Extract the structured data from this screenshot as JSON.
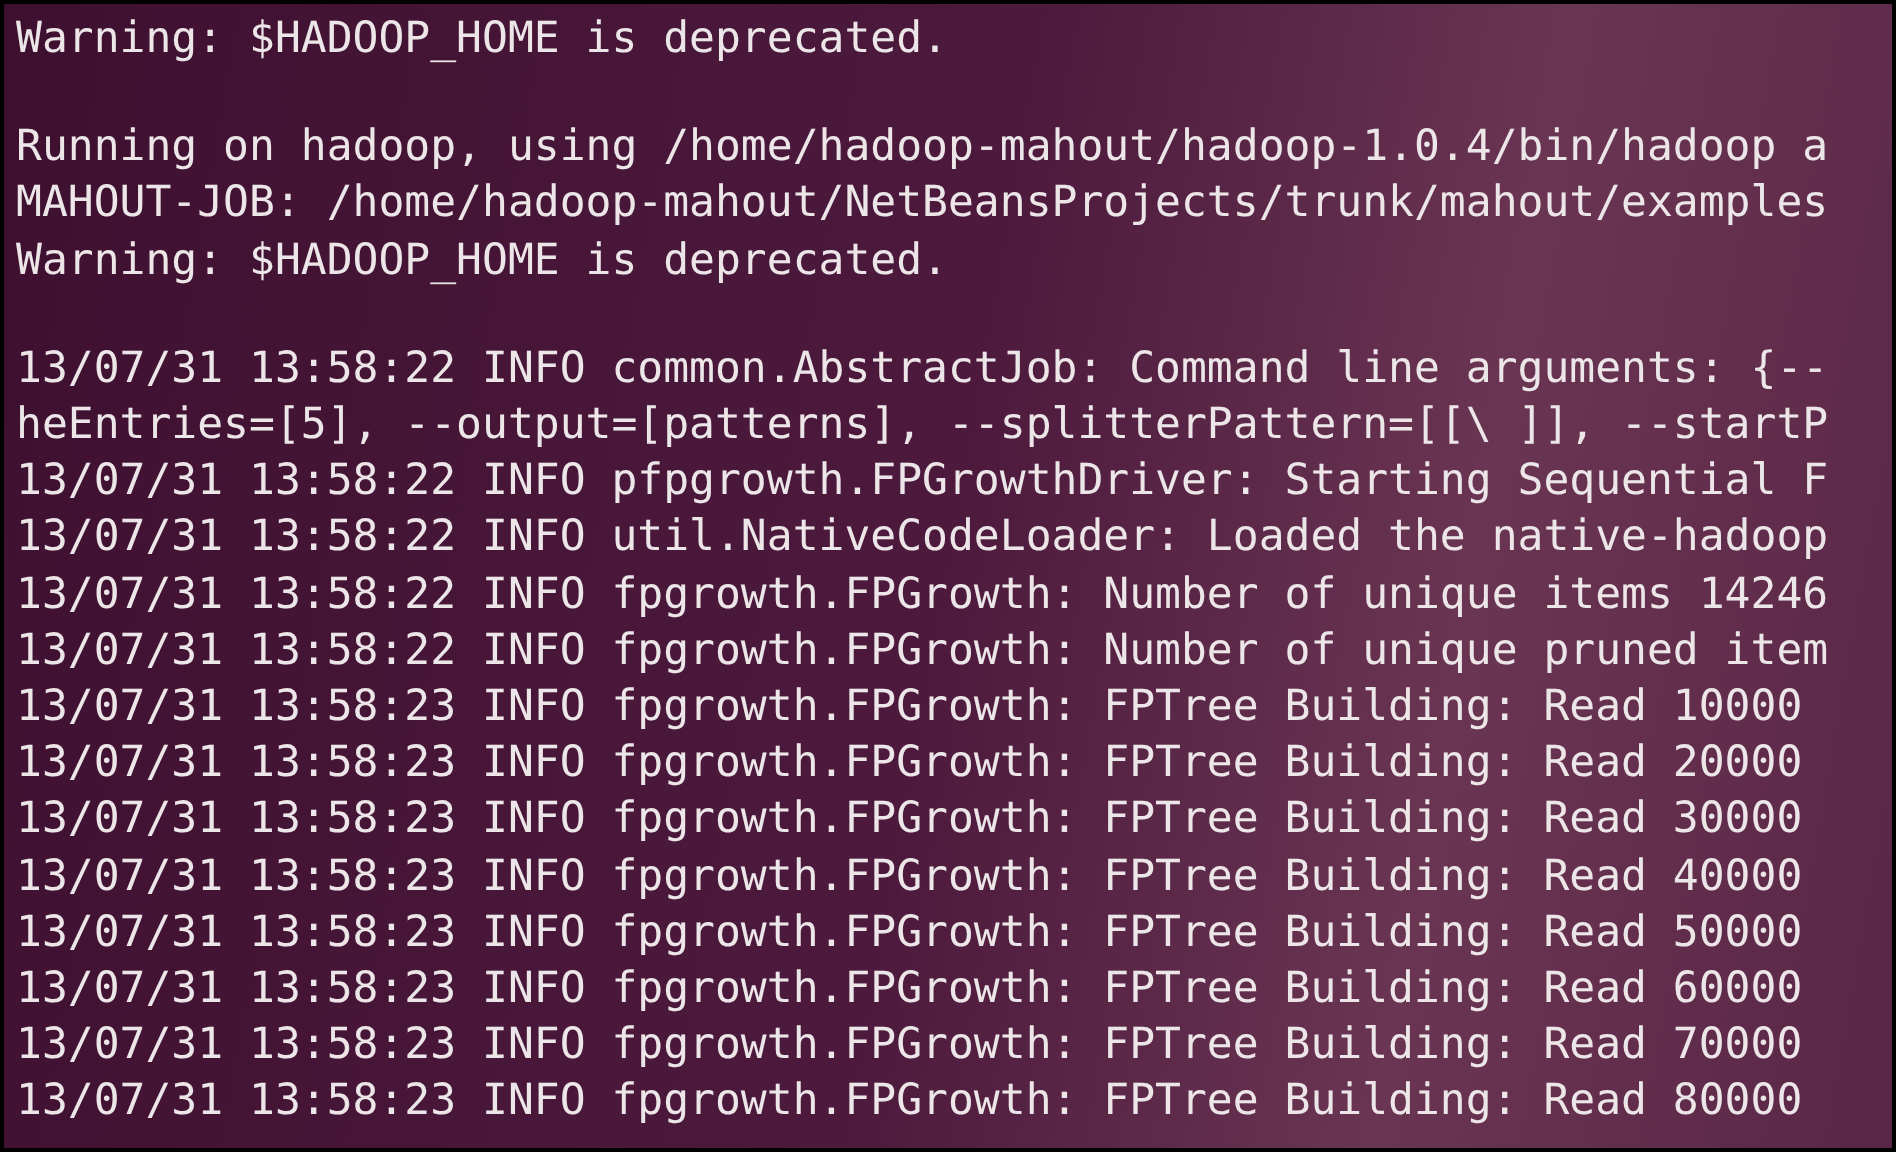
{
  "terminal": {
    "blocks": [
      [
        "Warning: $HADOOP_HOME is deprecated."
      ],
      [
        "Running on hadoop, using /home/hadoop-mahout/hadoop-1.0.4/bin/hadoop a",
        "MAHOUT-JOB: /home/hadoop-mahout/NetBeansProjects/trunk/mahout/examples",
        "Warning: $HADOOP_HOME is deprecated."
      ],
      [
        "13/07/31 13:58:22 INFO common.AbstractJob: Command line arguments: {--",
        "heEntries=[5], --output=[patterns], --splitterPattern=[[\\ ]], --startP",
        "13/07/31 13:58:22 INFO pfpgrowth.FPGrowthDriver: Starting Sequential F",
        "13/07/31 13:58:22 INFO util.NativeCodeLoader: Loaded the native-hadoop",
        "13/07/31 13:58:22 INFO fpgrowth.FPGrowth: Number of unique items 14246",
        "13/07/31 13:58:22 INFO fpgrowth.FPGrowth: Number of unique pruned item",
        "13/07/31 13:58:23 INFO fpgrowth.FPGrowth: FPTree Building: Read 10000",
        "13/07/31 13:58:23 INFO fpgrowth.FPGrowth: FPTree Building: Read 20000",
        "13/07/31 13:58:23 INFO fpgrowth.FPGrowth: FPTree Building: Read 30000",
        "13/07/31 13:58:23 INFO fpgrowth.FPGrowth: FPTree Building: Read 40000",
        "13/07/31 13:58:23 INFO fpgrowth.FPGrowth: FPTree Building: Read 50000",
        "13/07/31 13:58:23 INFO fpgrowth.FPGrowth: FPTree Building: Read 60000",
        "13/07/31 13:58:23 INFO fpgrowth.FPGrowth: FPTree Building: Read 70000",
        "13/07/31 13:58:23 INFO fpgrowth.FPGrowth: FPTree Building: Read 80000"
      ]
    ]
  }
}
